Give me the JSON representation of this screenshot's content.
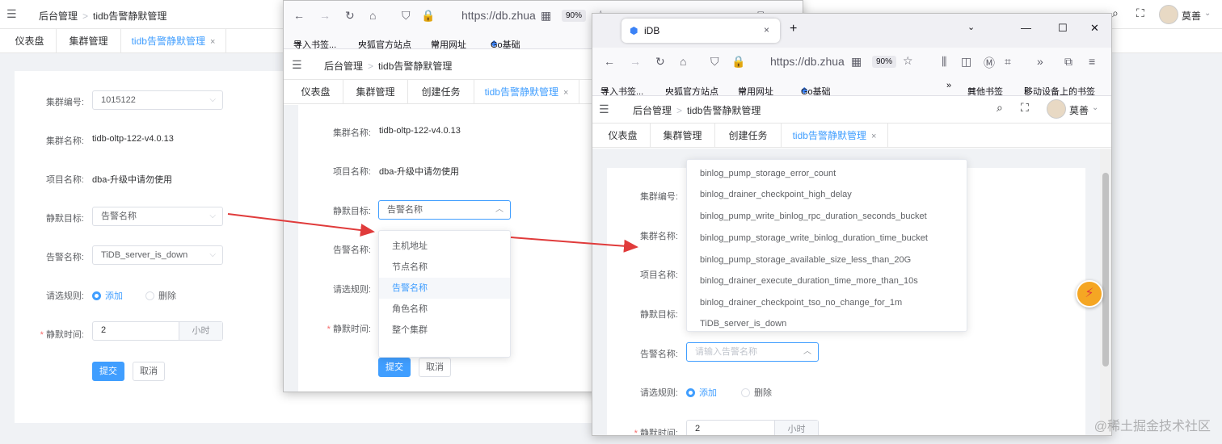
{
  "breadcrumb": {
    "home": "后台管理",
    "current": "tidb告警静默管理"
  },
  "tabs": {
    "dashboard": "仪表盘",
    "cluster": "集群管理",
    "create_task": "创建任务",
    "silence": "tidb告警静默管理"
  },
  "labels": {
    "cluster_id": "集群编号:",
    "cluster_name": "集群名称:",
    "project_name": "项目名称:",
    "target": "静默目标:",
    "alert_name": "告警名称:",
    "rule": "请选规则:",
    "time": "静默时间:"
  },
  "values": {
    "cluster_id": "1015122",
    "cluster_name": "tidb-oltp-122-v4.0.13",
    "project_name": "dba-升级中请勿使用",
    "target": "告警名称",
    "alert_name": "TiDB_server_is_down",
    "rule_add": "添加",
    "rule_delete": "删除",
    "time_value": "2",
    "time_unit": "小时",
    "required_mark": "*"
  },
  "buttons": {
    "submit": "提交",
    "cancel": "取消"
  },
  "user": {
    "name": "莫善"
  },
  "browser": {
    "url": "https://db.zhua",
    "zoom": "90%",
    "tab_title": "iDB",
    "new_tab": "+",
    "bookmarks": {
      "import": "导入书签...",
      "firefox": "火狐官方站点",
      "common": "常用网址",
      "go": "Go基础",
      "other": "其他书签",
      "mobile": "移动设备上的书签"
    }
  },
  "target_options": [
    "主机地址",
    "节点名称",
    "告警名称",
    "角色名称",
    "整个集群"
  ],
  "alert_options": [
    "binlog_pump_storage_error_count",
    "binlog_drainer_checkpoint_high_delay",
    "binlog_pump_write_binlog_rpc_duration_seconds_bucket",
    "binlog_pump_storage_write_binlog_duration_time_bucket",
    "binlog_pump_storage_available_size_less_than_20G",
    "binlog_drainer_execute_duration_time_more_than_10s",
    "binlog_drainer_checkpoint_tso_no_change_for_1m",
    "TiDB_server_is_down"
  ],
  "alert_placeholder": "请输入告警名称",
  "watermark": "@稀土掘金技术社区",
  "colors": {
    "primary": "#409eff",
    "arrow": "#e03b3b",
    "required": "#f56c6c"
  }
}
